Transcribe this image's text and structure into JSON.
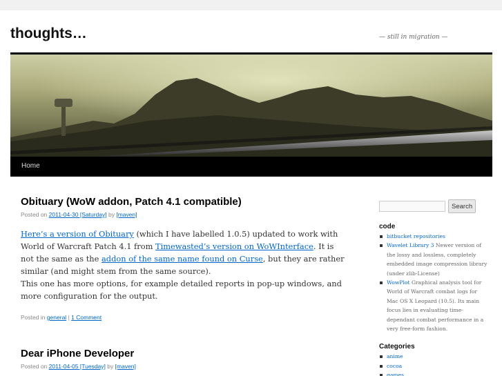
{
  "site": {
    "title": "thoughts…",
    "description": "— still in migration —"
  },
  "nav": {
    "home": "Home"
  },
  "posts": [
    {
      "title": "Obituary (WoW addon, Patch 4.1 compatible)",
      "meta_posted_on": "Posted on",
      "meta_date": "2011-04-30 [Saturday]",
      "meta_by": "by",
      "meta_author": "[maven]",
      "content": {
        "link1": "Here’s a version of Obituary",
        "text1": " (which I have labelled 1.0.5) updated to work with World of Warcraft Patch 4.1 from ",
        "link2": "Timewasted’s version on WoWInterface",
        "text2": ". It is not the same as the ",
        "link3": "addon of the same name found on Curse",
        "text3": ", but they are rather similar (and might stem from the same source).",
        "para2": "This one has more options, for example detailed reports in pop-up windows, and more configuration for the output."
      },
      "util_posted_in": "Posted in",
      "util_category": "general",
      "util_sep": "|",
      "util_comments": "1 Comment"
    },
    {
      "title": "Dear iPhone Developer",
      "meta_posted_on": "Posted on",
      "meta_date": "2011-04-05 [Tuesday]",
      "meta_by": "by",
      "meta_author": "[maven]"
    }
  ],
  "sidebar": {
    "search_button": "Search",
    "search_value": "",
    "code": {
      "title": "code",
      "items": [
        {
          "link": "bitbucket repositories",
          "desc": ""
        },
        {
          "link": "Wavelet Library 3",
          "desc": " Newer version of the lossy and lossless, completely embedded image compression library (under zlib-License)"
        },
        {
          "link": "WowPlot",
          "desc": " Graphical analysis tool for World of Warcraft combat logs for Mac OS X Leopard (10.5). Its main focus lies in evaluating time-dependant combat performance in a very free-form fashion."
        }
      ]
    },
    "categories": {
      "title": "Categories",
      "items": [
        "anime",
        "cocoa",
        "games"
      ]
    }
  },
  "colors": {
    "link": "#0066cc",
    "nav_bar": "#000000",
    "page_bg": "#f1f1f1"
  }
}
